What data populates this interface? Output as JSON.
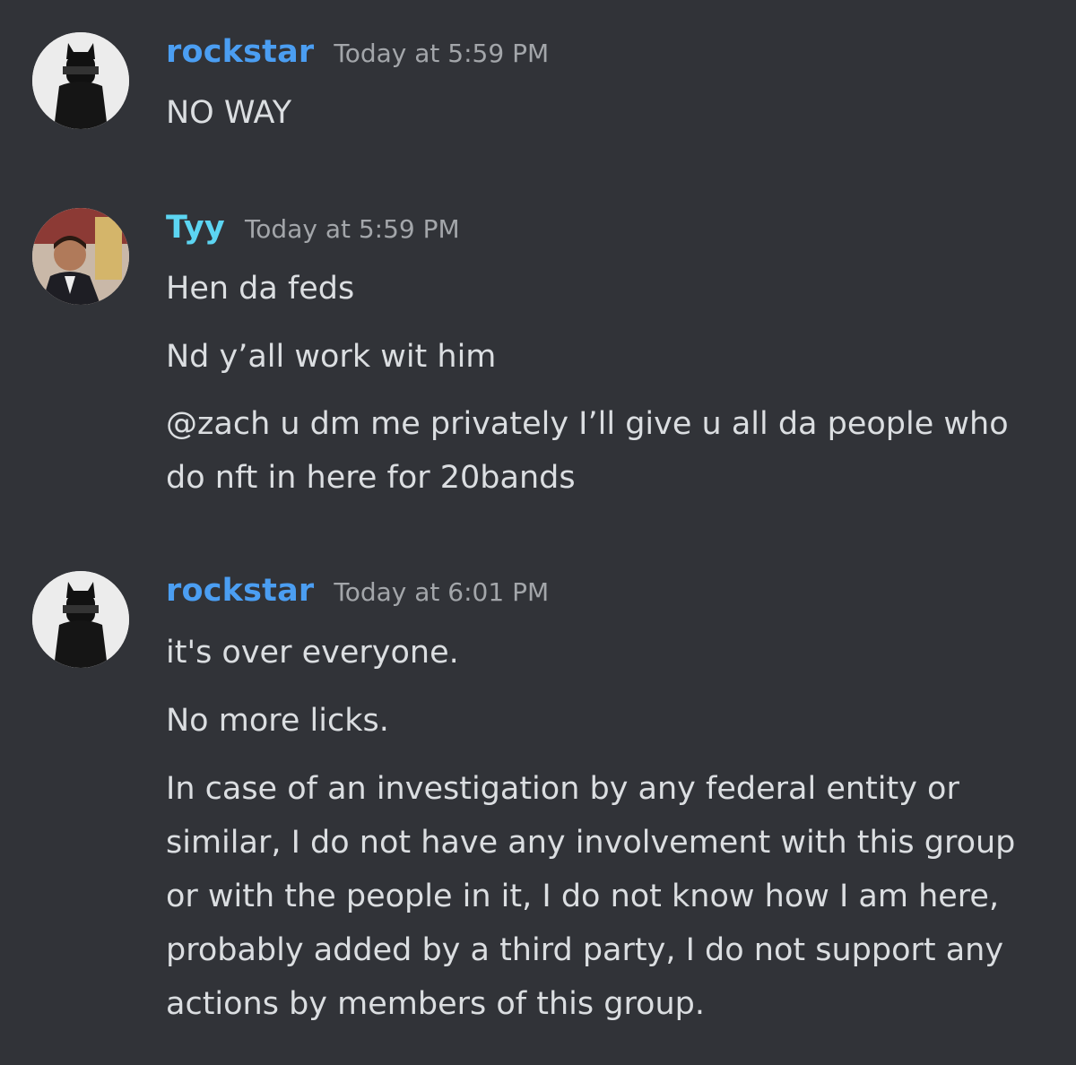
{
  "colors": {
    "background": "#313338",
    "text": "#dbdee1",
    "timestamp": "#a3a6aa",
    "rockstar_name": "#4b9ef2",
    "tyy_name": "#5cd5f2"
  },
  "messages": [
    {
      "author": "rockstar",
      "timestamp": "Today at 5:59 PM",
      "avatar_icon": "masked-figure-avatar",
      "lines": [
        "NO WAY"
      ]
    },
    {
      "author": "Tyy",
      "timestamp": "Today at 5:59 PM",
      "avatar_icon": "man-portrait-avatar",
      "lines": [
        "Hen da feds",
        "Nd y’all work wit him",
        "@zach u dm me privately I’ll give u all da people who do nft in here for 20bands"
      ]
    },
    {
      "author": "rockstar",
      "timestamp": "Today at 6:01 PM",
      "avatar_icon": "masked-figure-avatar",
      "lines": [
        "it's over everyone.",
        "No more licks.",
        "In case of an investigation by any federal entity or similar, I do not have any involvement with this group or with the people in it, I do not know how I am here, probably added by a third party, I do not support any actions by members of this group."
      ]
    }
  ]
}
